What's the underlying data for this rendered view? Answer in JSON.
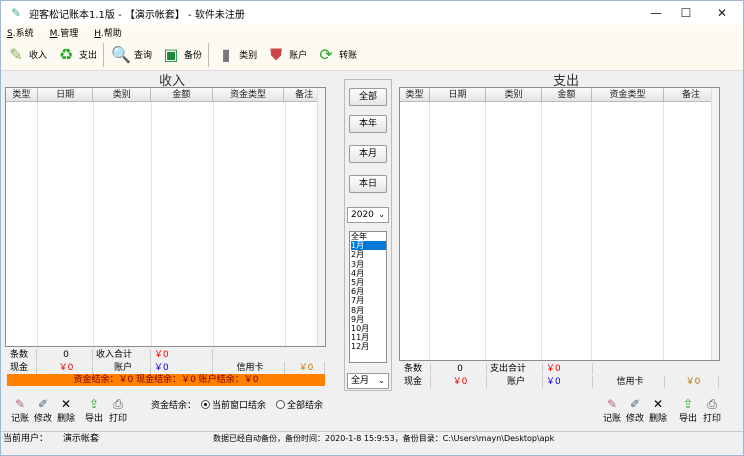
{
  "window": {
    "title": "迎客松记账本1.1版 - 【演示帐套】 - 软件未注册",
    "min": "—",
    "max": "☐",
    "close": "✕"
  },
  "menu": [
    {
      "key": "S",
      "label": "系统"
    },
    {
      "key": "M",
      "label": "管理"
    },
    {
      "key": "H",
      "label": "帮助"
    }
  ],
  "toolbar": {
    "income": "收入",
    "expense": "支出",
    "query": "查询",
    "backup": "备份",
    "category": "类别",
    "account": "账户",
    "transfer": "转账"
  },
  "income": {
    "title": "收入",
    "columns": [
      "类型",
      "日期",
      "类别",
      "金额",
      "资金类型",
      "备注"
    ],
    "count_label": "条数",
    "count_value": "0",
    "total_label": "收入合计",
    "total_value": "￥0",
    "cash_label": "现金",
    "cash_value": "￥0",
    "account_label": "账户",
    "account_value": "￥0",
    "credit_label": "信用卡",
    "credit_value": "￥0",
    "balance_text": "资金结余：￥0  现金结余：￥0  账户结余：￥0"
  },
  "expense": {
    "title": "支出",
    "columns": [
      "类型",
      "日期",
      "类别",
      "金额",
      "资金类型",
      "备注"
    ],
    "count_label": "条数",
    "count_value": "0",
    "total_label": "支出合计",
    "total_value": "￥0",
    "cash_label": "现金",
    "cash_value": "￥0",
    "account_label": "账户",
    "account_value": "￥0",
    "credit_label": "信用卡",
    "credit_value": "￥0"
  },
  "middle": {
    "all": "全部",
    "year": "本年",
    "month": "本月",
    "day": "本日",
    "year_select": "2020",
    "months": [
      "全年",
      "1月",
      "2月",
      "3月",
      "4月",
      "5月",
      "6月",
      "7月",
      "8月",
      "9月",
      "10月",
      "11月",
      "12月"
    ],
    "selected_month": "1月",
    "month_select": "全月"
  },
  "bottom": {
    "record": "记账",
    "edit": "修改",
    "delete": "删除",
    "export": "导出",
    "print": "打印",
    "balance_label": "资金结余：",
    "radio_current": "当前窗口结余",
    "radio_all": "全部结余"
  },
  "status": {
    "user_label": "当前用户：",
    "user_value": "演示帐套",
    "backup_text": "数据已经自动备份，备份时间：2020-1-8 15:9:53，备份目录：C:\\Users\\mayn\\Desktop\\apk"
  }
}
